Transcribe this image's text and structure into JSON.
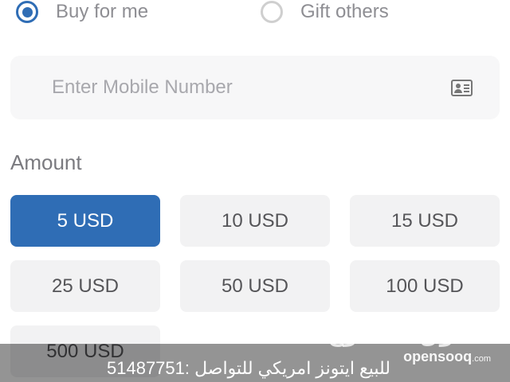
{
  "purchase_type": {
    "options": [
      {
        "label": "Buy for me",
        "checked": true
      },
      {
        "label": "Gift others",
        "checked": false
      }
    ]
  },
  "phone": {
    "placeholder": "Enter Mobile Number",
    "value": "",
    "icon": "contacts-card-icon"
  },
  "amount": {
    "label": "Amount",
    "selected": "5 USD",
    "options": [
      "5 USD",
      "10 USD",
      "15 USD",
      "25 USD",
      "50 USD",
      "100 USD",
      "500 USD"
    ]
  },
  "overlay": {
    "text": "للبيع ايتونز امريكي للتواصل :51487751",
    "watermark_ar": "السوق المفتوح",
    "watermark_en": "opensooq",
    "watermark_domain": ".com"
  },
  "colors": {
    "accent": "#2f6db5",
    "button_bg": "#f2f2f3",
    "field_bg": "#f7f7f8",
    "label_gray": "#8e8e93"
  }
}
